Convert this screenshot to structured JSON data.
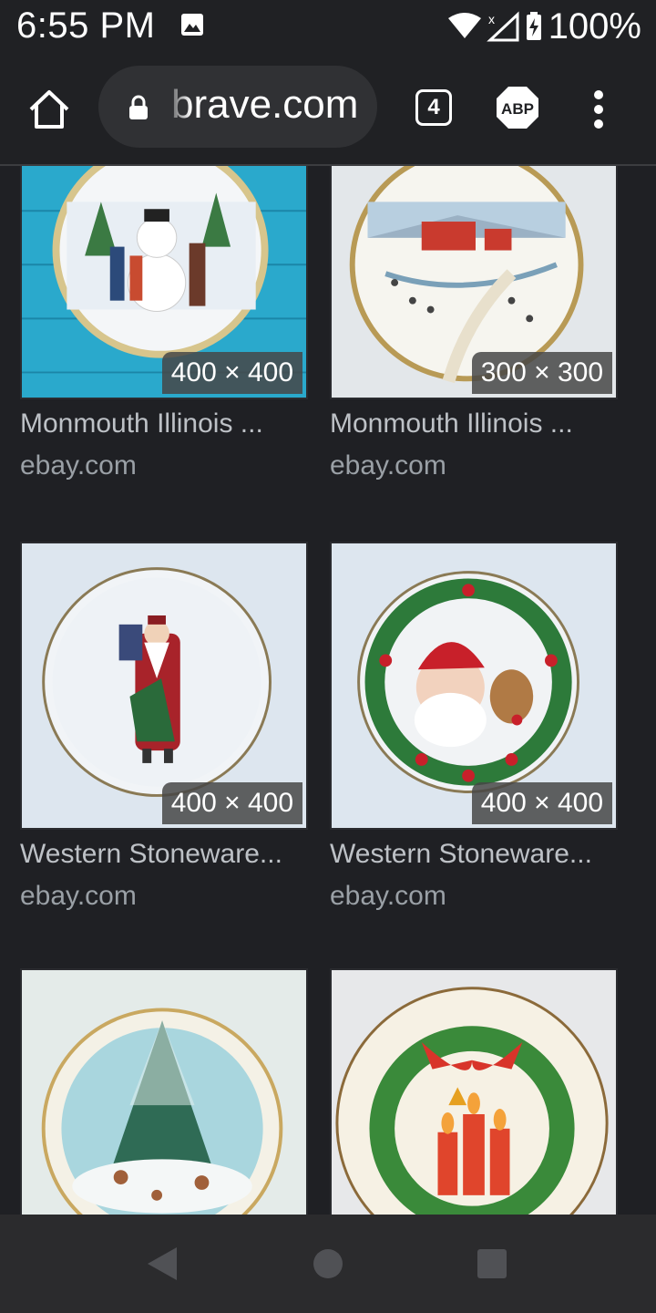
{
  "status_bar": {
    "time": "6:55 PM",
    "battery_pct": "100%"
  },
  "toolbar": {
    "url_text": "brave.com",
    "tab_count": "4",
    "abp_label": "ABP"
  },
  "results": [
    {
      "title": "Monmouth Illinois ...",
      "source": "ebay.com",
      "dims": "400 × 400"
    },
    {
      "title": "Monmouth Illinois ...",
      "source": "ebay.com",
      "dims": "300 × 300"
    },
    {
      "title": "Western Stoneware...",
      "source": "ebay.com",
      "dims": "400 × 400"
    },
    {
      "title": "Western Stoneware...",
      "source": "ebay.com",
      "dims": "400 × 400"
    },
    {
      "title": "",
      "source": "",
      "dims": ""
    },
    {
      "title": "",
      "source": "",
      "dims": ""
    }
  ]
}
